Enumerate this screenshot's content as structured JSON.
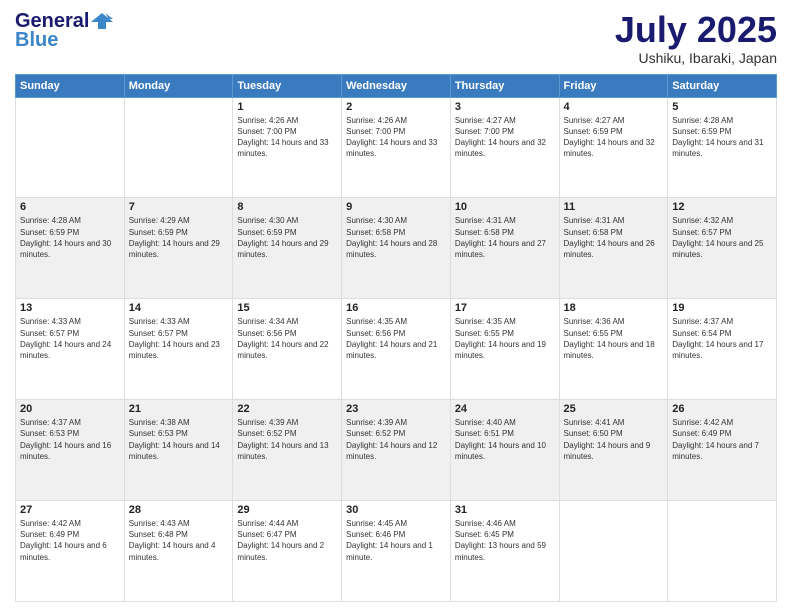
{
  "header": {
    "logo_line1": "General",
    "logo_line2": "Blue",
    "main_title": "July 2025",
    "subtitle": "Ushiku, Ibaraki, Japan"
  },
  "weekdays": [
    "Sunday",
    "Monday",
    "Tuesday",
    "Wednesday",
    "Thursday",
    "Friday",
    "Saturday"
  ],
  "weeks": [
    [
      {
        "day": "",
        "info": ""
      },
      {
        "day": "",
        "info": ""
      },
      {
        "day": "1",
        "info": "Sunrise: 4:26 AM\nSunset: 7:00 PM\nDaylight: 14 hours and 33 minutes."
      },
      {
        "day": "2",
        "info": "Sunrise: 4:26 AM\nSunset: 7:00 PM\nDaylight: 14 hours and 33 minutes."
      },
      {
        "day": "3",
        "info": "Sunrise: 4:27 AM\nSunset: 7:00 PM\nDaylight: 14 hours and 32 minutes."
      },
      {
        "day": "4",
        "info": "Sunrise: 4:27 AM\nSunset: 6:59 PM\nDaylight: 14 hours and 32 minutes."
      },
      {
        "day": "5",
        "info": "Sunrise: 4:28 AM\nSunset: 6:59 PM\nDaylight: 14 hours and 31 minutes."
      }
    ],
    [
      {
        "day": "6",
        "info": "Sunrise: 4:28 AM\nSunset: 6:59 PM\nDaylight: 14 hours and 30 minutes."
      },
      {
        "day": "7",
        "info": "Sunrise: 4:29 AM\nSunset: 6:59 PM\nDaylight: 14 hours and 29 minutes."
      },
      {
        "day": "8",
        "info": "Sunrise: 4:30 AM\nSunset: 6:59 PM\nDaylight: 14 hours and 29 minutes."
      },
      {
        "day": "9",
        "info": "Sunrise: 4:30 AM\nSunset: 6:58 PM\nDaylight: 14 hours and 28 minutes."
      },
      {
        "day": "10",
        "info": "Sunrise: 4:31 AM\nSunset: 6:58 PM\nDaylight: 14 hours and 27 minutes."
      },
      {
        "day": "11",
        "info": "Sunrise: 4:31 AM\nSunset: 6:58 PM\nDaylight: 14 hours and 26 minutes."
      },
      {
        "day": "12",
        "info": "Sunrise: 4:32 AM\nSunset: 6:57 PM\nDaylight: 14 hours and 25 minutes."
      }
    ],
    [
      {
        "day": "13",
        "info": "Sunrise: 4:33 AM\nSunset: 6:57 PM\nDaylight: 14 hours and 24 minutes."
      },
      {
        "day": "14",
        "info": "Sunrise: 4:33 AM\nSunset: 6:57 PM\nDaylight: 14 hours and 23 minutes."
      },
      {
        "day": "15",
        "info": "Sunrise: 4:34 AM\nSunset: 6:56 PM\nDaylight: 14 hours and 22 minutes."
      },
      {
        "day": "16",
        "info": "Sunrise: 4:35 AM\nSunset: 6:56 PM\nDaylight: 14 hours and 21 minutes."
      },
      {
        "day": "17",
        "info": "Sunrise: 4:35 AM\nSunset: 6:55 PM\nDaylight: 14 hours and 19 minutes."
      },
      {
        "day": "18",
        "info": "Sunrise: 4:36 AM\nSunset: 6:55 PM\nDaylight: 14 hours and 18 minutes."
      },
      {
        "day": "19",
        "info": "Sunrise: 4:37 AM\nSunset: 6:54 PM\nDaylight: 14 hours and 17 minutes."
      }
    ],
    [
      {
        "day": "20",
        "info": "Sunrise: 4:37 AM\nSunset: 6:53 PM\nDaylight: 14 hours and 16 minutes."
      },
      {
        "day": "21",
        "info": "Sunrise: 4:38 AM\nSunset: 6:53 PM\nDaylight: 14 hours and 14 minutes."
      },
      {
        "day": "22",
        "info": "Sunrise: 4:39 AM\nSunset: 6:52 PM\nDaylight: 14 hours and 13 minutes."
      },
      {
        "day": "23",
        "info": "Sunrise: 4:39 AM\nSunset: 6:52 PM\nDaylight: 14 hours and 12 minutes."
      },
      {
        "day": "24",
        "info": "Sunrise: 4:40 AM\nSunset: 6:51 PM\nDaylight: 14 hours and 10 minutes."
      },
      {
        "day": "25",
        "info": "Sunrise: 4:41 AM\nSunset: 6:50 PM\nDaylight: 14 hours and 9 minutes."
      },
      {
        "day": "26",
        "info": "Sunrise: 4:42 AM\nSunset: 6:49 PM\nDaylight: 14 hours and 7 minutes."
      }
    ],
    [
      {
        "day": "27",
        "info": "Sunrise: 4:42 AM\nSunset: 6:49 PM\nDaylight: 14 hours and 6 minutes."
      },
      {
        "day": "28",
        "info": "Sunrise: 4:43 AM\nSunset: 6:48 PM\nDaylight: 14 hours and 4 minutes."
      },
      {
        "day": "29",
        "info": "Sunrise: 4:44 AM\nSunset: 6:47 PM\nDaylight: 14 hours and 2 minutes."
      },
      {
        "day": "30",
        "info": "Sunrise: 4:45 AM\nSunset: 6:46 PM\nDaylight: 14 hours and 1 minute."
      },
      {
        "day": "31",
        "info": "Sunrise: 4:46 AM\nSunset: 6:45 PM\nDaylight: 13 hours and 59 minutes."
      },
      {
        "day": "",
        "info": ""
      },
      {
        "day": "",
        "info": ""
      }
    ]
  ]
}
